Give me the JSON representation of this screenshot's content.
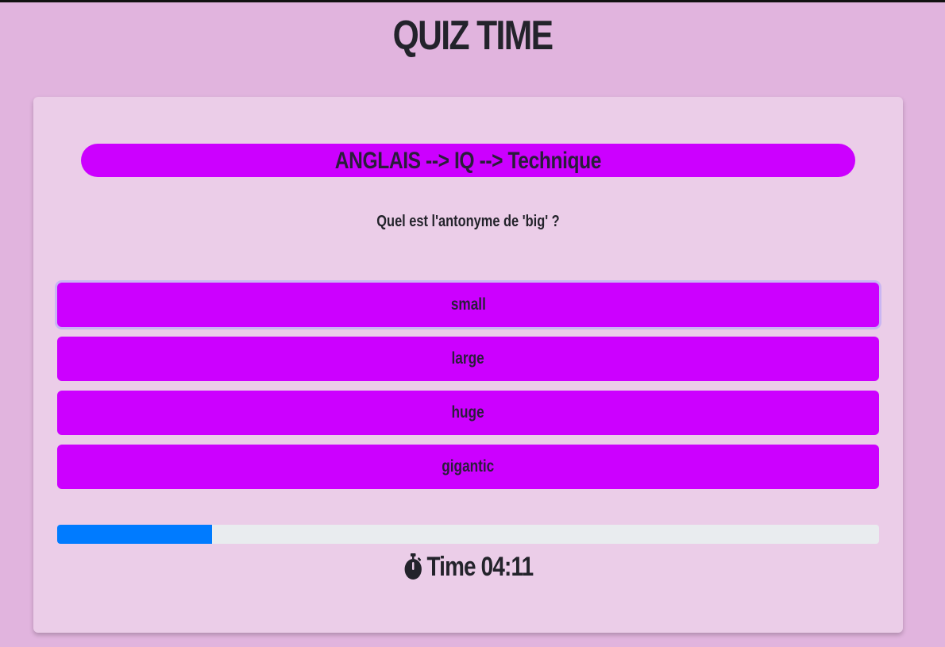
{
  "header": {
    "title": "QUIZ TIME"
  },
  "quiz": {
    "category": "ANGLAIS --> IQ --> Technique",
    "question": "Quel est l'antonyme de 'big' ?",
    "answers": [
      {
        "label": "small",
        "focused": true
      },
      {
        "label": "large"
      },
      {
        "label": "huge"
      },
      {
        "label": "gigantic"
      }
    ],
    "progress_fraction": 0.188,
    "timer": {
      "icon": "stopwatch-icon",
      "label": "Time 04:11"
    }
  },
  "colors": {
    "page_background": "#e1b4de",
    "card_background": "#ebcde8",
    "accent": "#cc00ff",
    "progress": "#007bff",
    "track": "#e9ecef"
  }
}
